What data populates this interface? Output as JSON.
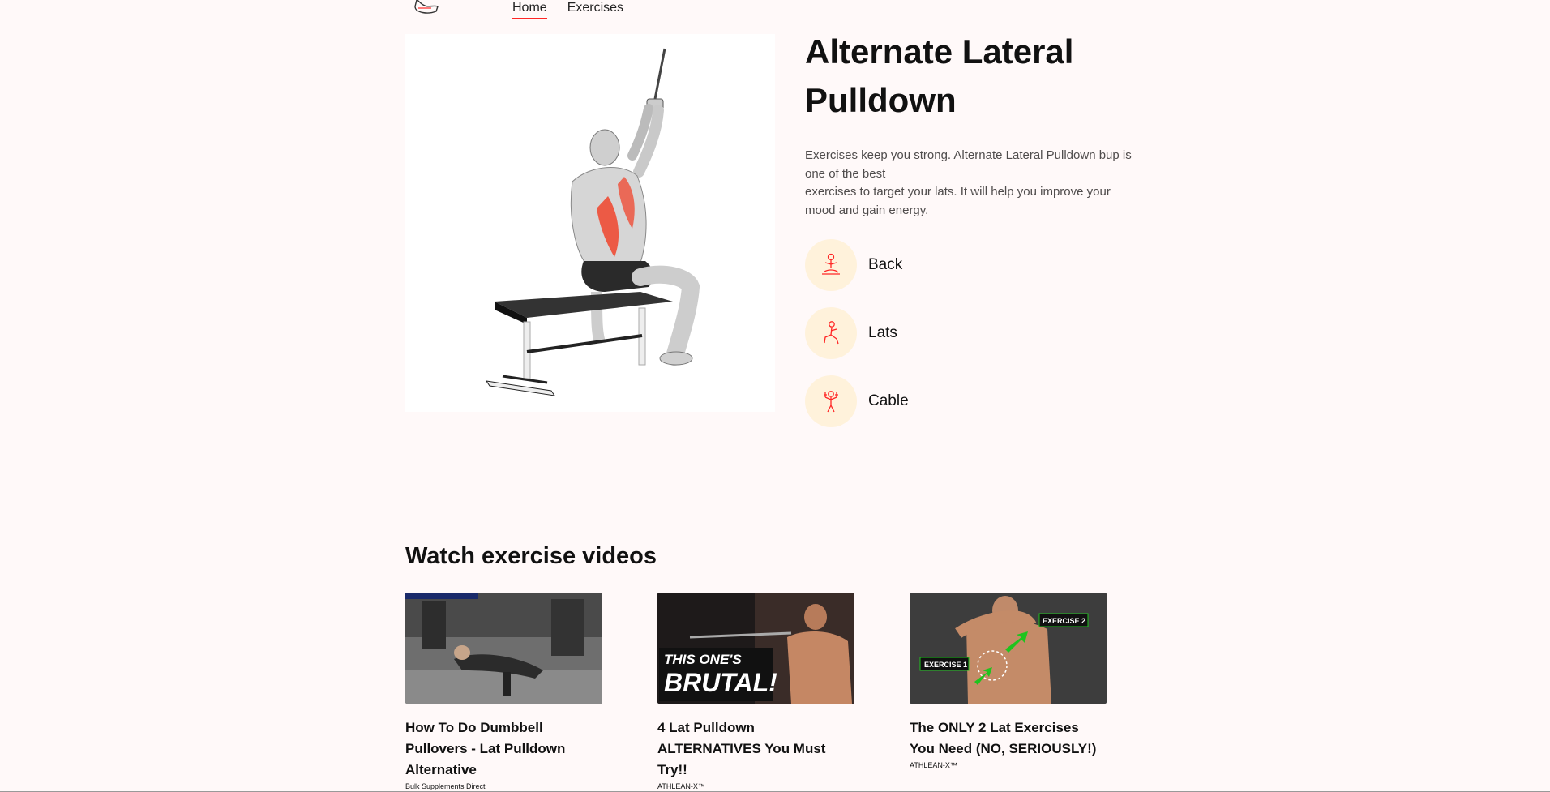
{
  "nav": {
    "links": [
      {
        "label": "Home",
        "active": true
      },
      {
        "label": "Exercises",
        "active": false
      }
    ]
  },
  "exercise": {
    "name": "Alternate Lateral Pulldown",
    "description_line1": "Exercises keep you strong. Alternate Lateral Pulldown bup is one of the best",
    "description_line2": "exercises to target your lats. It will help you improve your mood and gain energy.",
    "extras": [
      {
        "label": "Back",
        "icon": "body-part-icon"
      },
      {
        "label": "Lats",
        "icon": "target-muscle-icon"
      },
      {
        "label": "Cable",
        "icon": "equipment-icon"
      }
    ]
  },
  "videos_section": {
    "title": "Watch exercise videos",
    "videos": [
      {
        "title": "How To Do Dumbbell Pullovers - Lat Pulldown Alternative",
        "channel": "Bulk Supplements Direct"
      },
      {
        "title": "4 Lat Pulldown ALTERNATIVES You Must Try!!",
        "channel": "ATHLEAN-X™",
        "thumb_text_1": "THIS ONE'S",
        "thumb_text_2": "BRUTAL!"
      },
      {
        "title": "The ONLY 2 Lat Exercises You Need (NO, SERIOUSLY!)",
        "channel": "ATHLEAN-X™",
        "thumb_tag_1": "EXERCISE 1",
        "thumb_tag_2": "EXERCISE 2"
      }
    ]
  },
  "colors": {
    "accent": "#ff2625",
    "badge_bg": "#fff2db",
    "page_bg": "#fff9f9"
  }
}
